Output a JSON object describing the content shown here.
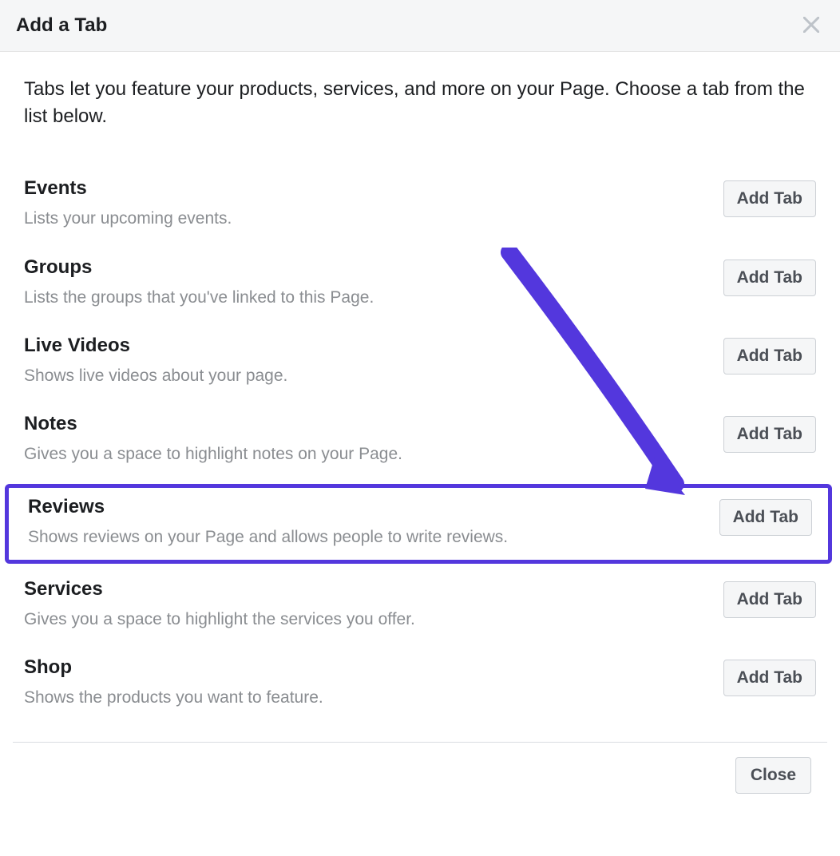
{
  "header": {
    "title": "Add a Tab"
  },
  "intro": "Tabs let you feature your products, services, and more on your Page. Choose a tab from the list below.",
  "add_button_label": "Add Tab",
  "tabs": [
    {
      "name": "Events",
      "desc": "Lists your upcoming events."
    },
    {
      "name": "Groups",
      "desc": "Lists the groups that you've linked to this Page."
    },
    {
      "name": "Live Videos",
      "desc": "Shows live videos about your page."
    },
    {
      "name": "Notes",
      "desc": "Gives you a space to highlight notes on your Page."
    },
    {
      "name": "Reviews",
      "desc": "Shows reviews on your Page and allows people to write reviews."
    },
    {
      "name": "Services",
      "desc": "Gives you a space to highlight the services you offer."
    },
    {
      "name": "Shop",
      "desc": "Shows the products you want to feature."
    }
  ],
  "highlighted_index": 4,
  "footer": {
    "close_label": "Close"
  },
  "annotation": {
    "arrow_color": "#5337dd"
  }
}
